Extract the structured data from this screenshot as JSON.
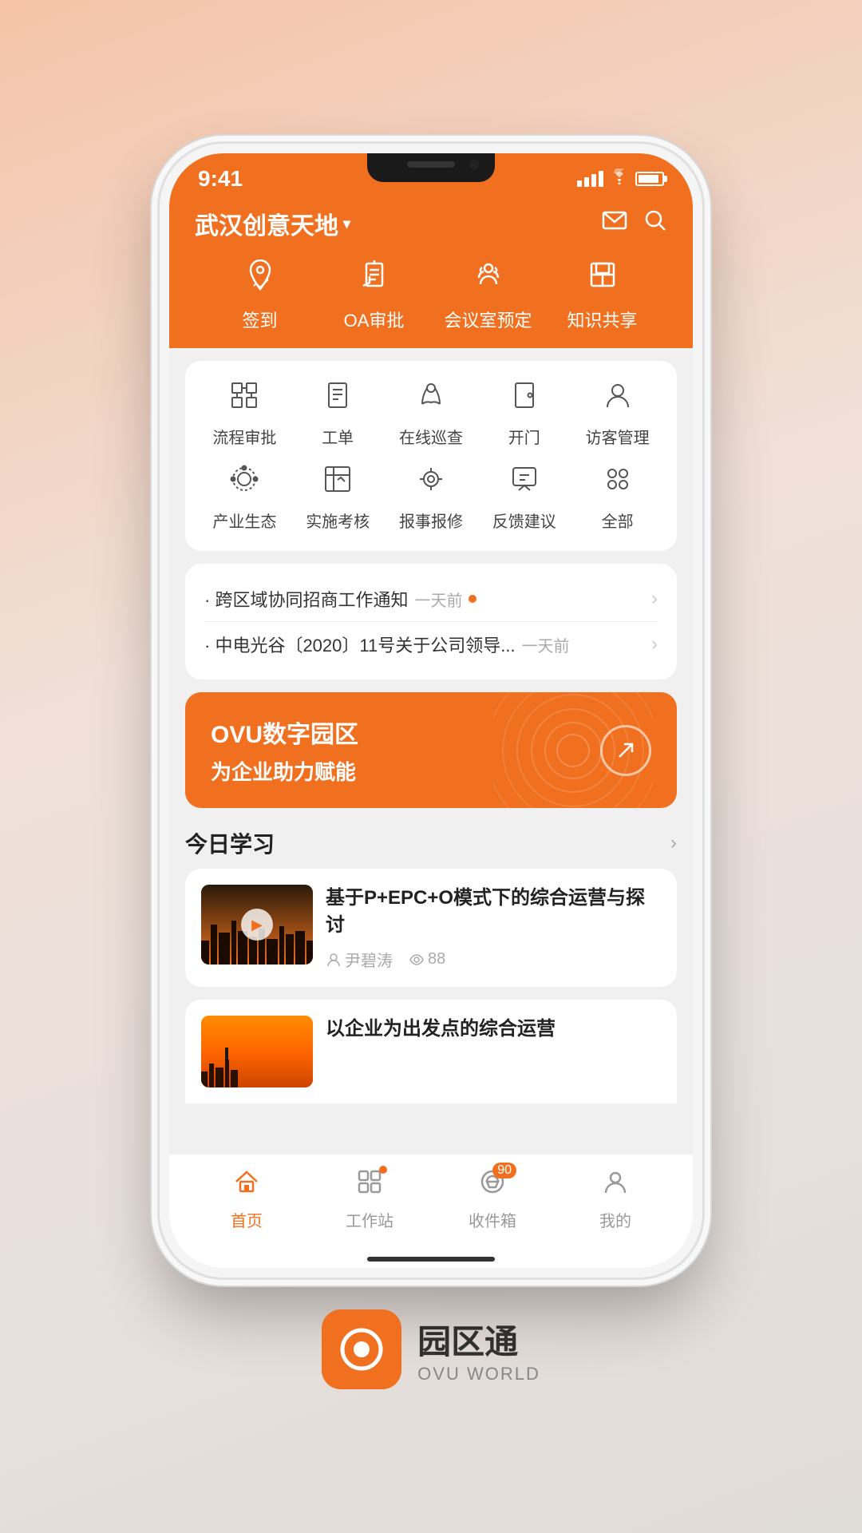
{
  "statusBar": {
    "time": "9:41"
  },
  "header": {
    "location": "武汉创意天地",
    "inboxIcon": "inbox-icon",
    "searchIcon": "search-icon"
  },
  "quickActions": [
    {
      "id": "checkin",
      "label": "签到",
      "icon": "📍"
    },
    {
      "id": "oa",
      "label": "OA审批",
      "icon": "⚗"
    },
    {
      "id": "meeting",
      "label": "会议室预定",
      "icon": "👤"
    },
    {
      "id": "knowledge",
      "label": "知识共享",
      "icon": "🏛"
    }
  ],
  "secondaryMenu": {
    "row1": [
      {
        "id": "workflow",
        "label": "流程审批"
      },
      {
        "id": "workorder",
        "label": "工单"
      },
      {
        "id": "inspection",
        "label": "在线巡查"
      },
      {
        "id": "door",
        "label": "开门"
      },
      {
        "id": "visitor",
        "label": "访客管理"
      }
    ],
    "row2": [
      {
        "id": "ecosystem",
        "label": "产业生态"
      },
      {
        "id": "evaluation",
        "label": "实施考核"
      },
      {
        "id": "repair",
        "label": "报事报修"
      },
      {
        "id": "feedback",
        "label": "反馈建议"
      },
      {
        "id": "all",
        "label": "全部"
      }
    ]
  },
  "notifications": [
    {
      "text": "跨区域协同招商工作通知",
      "time": "一天前",
      "hasDot": true
    },
    {
      "text": "中电光谷〔2020〕11号关于公司领导...",
      "time": "一天前",
      "hasDot": false
    }
  ],
  "ovuBanner": {
    "title": "OVU数字园区",
    "subtitle": "为企业助力赋能",
    "arrowIcon": "↗"
  },
  "todayLearning": {
    "sectionTitle": "今日学习",
    "moreArrow": "›",
    "items": [
      {
        "title": "基于P+EPC+O模式下的综合运营与探讨",
        "author": "尹碧涛",
        "views": "88"
      },
      {
        "title": "以企业为出发点的综合运营",
        "author": "",
        "views": ""
      }
    ]
  },
  "bottomNav": [
    {
      "id": "home",
      "label": "首页",
      "active": true,
      "badge": null,
      "dot": false
    },
    {
      "id": "workstation",
      "label": "工作站",
      "active": false,
      "badge": null,
      "dot": true
    },
    {
      "id": "inbox",
      "label": "收件箱",
      "active": false,
      "badge": "90",
      "dot": false
    },
    {
      "id": "mine",
      "label": "我的",
      "active": false,
      "badge": null,
      "dot": false
    }
  ],
  "brand": {
    "nameCn": "园区通",
    "nameEn": "OVU WORLD"
  }
}
